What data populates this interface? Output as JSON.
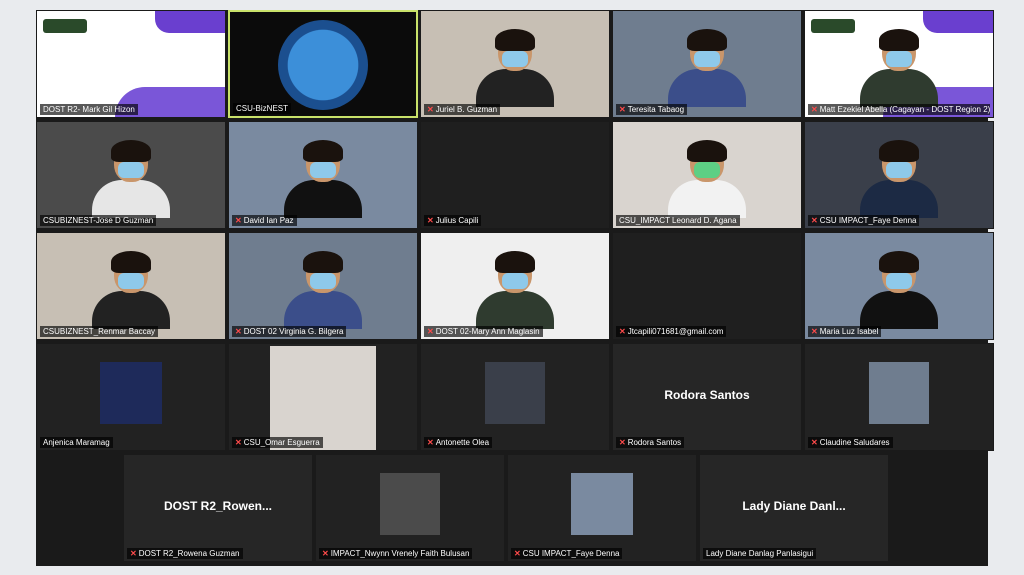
{
  "colors": {
    "frame": "#1a1a1a",
    "tile": "#2b2b2b",
    "active_border": "#c9e26a",
    "mic_muted": "#ff4b4b"
  },
  "rows": [
    {
      "tiles": [
        {
          "name": "DOST R2- Mark Gil Hizon",
          "muted": false,
          "kind": "slide"
        },
        {
          "name": "CSU-BizNEST",
          "muted": false,
          "kind": "logo",
          "active": true
        },
        {
          "name": "Juriel B. Guzman",
          "muted": true,
          "kind": "person"
        },
        {
          "name": "Teresita Tabaog",
          "muted": true,
          "kind": "person"
        },
        {
          "name": "Matt Ezekiel Abella (Cagayan - DOST Region 2)",
          "muted": true,
          "kind": "slide-person"
        }
      ]
    },
    {
      "tiles": [
        {
          "name": "CSUBIZNEST-Jose D Guzman",
          "muted": false,
          "kind": "person"
        },
        {
          "name": "David Ian Paz",
          "muted": true,
          "kind": "person"
        },
        {
          "name": "Julius Capili",
          "muted": true,
          "kind": "empty"
        },
        {
          "name": "CSU_IMPACT Leonard D. Agana",
          "muted": false,
          "kind": "person"
        },
        {
          "name": "CSU IMPACT_Faye Denna",
          "muted": true,
          "kind": "person"
        }
      ]
    },
    {
      "tiles": [
        {
          "name": "CSUBIZNEST_Renmar Baccay",
          "muted": false,
          "kind": "person"
        },
        {
          "name": "DOST 02 Virginia G. Bilgera",
          "muted": true,
          "kind": "person"
        },
        {
          "name": "DOST 02-Mary Ann Maglasin",
          "muted": true,
          "kind": "person"
        },
        {
          "name": "Jtcapili071681@gmail.com",
          "muted": true,
          "kind": "empty"
        },
        {
          "name": "Maria Luz Isabel",
          "muted": true,
          "kind": "person"
        }
      ]
    },
    {
      "tiles": [
        {
          "name": "Anjenica Maramag",
          "muted": false,
          "kind": "photo"
        },
        {
          "name": "CSU_Omar Esguerra",
          "muted": true,
          "kind": "photo"
        },
        {
          "name": "Antonette Olea",
          "muted": true,
          "kind": "photo"
        },
        {
          "name": "Rodora Santos",
          "muted": true,
          "kind": "text",
          "big": "Rodora Santos"
        },
        {
          "name": "Claudine Saludares",
          "muted": true,
          "kind": "photo"
        }
      ]
    },
    {
      "tiles": [
        {
          "name": "DOST R2_Rowena Guzman",
          "muted": true,
          "kind": "text",
          "big": "DOST  R2_Rowen..."
        },
        {
          "name": "IMPACT_Nwynn Vrenely Faith Bulusan",
          "muted": true,
          "kind": "photo"
        },
        {
          "name": "CSU IMPACT_Faye Denna",
          "muted": true,
          "kind": "photo"
        },
        {
          "name": "Lady Diane Danlag Panlasigui",
          "muted": false,
          "kind": "text",
          "big": "Lady Diane Danl..."
        }
      ]
    }
  ]
}
